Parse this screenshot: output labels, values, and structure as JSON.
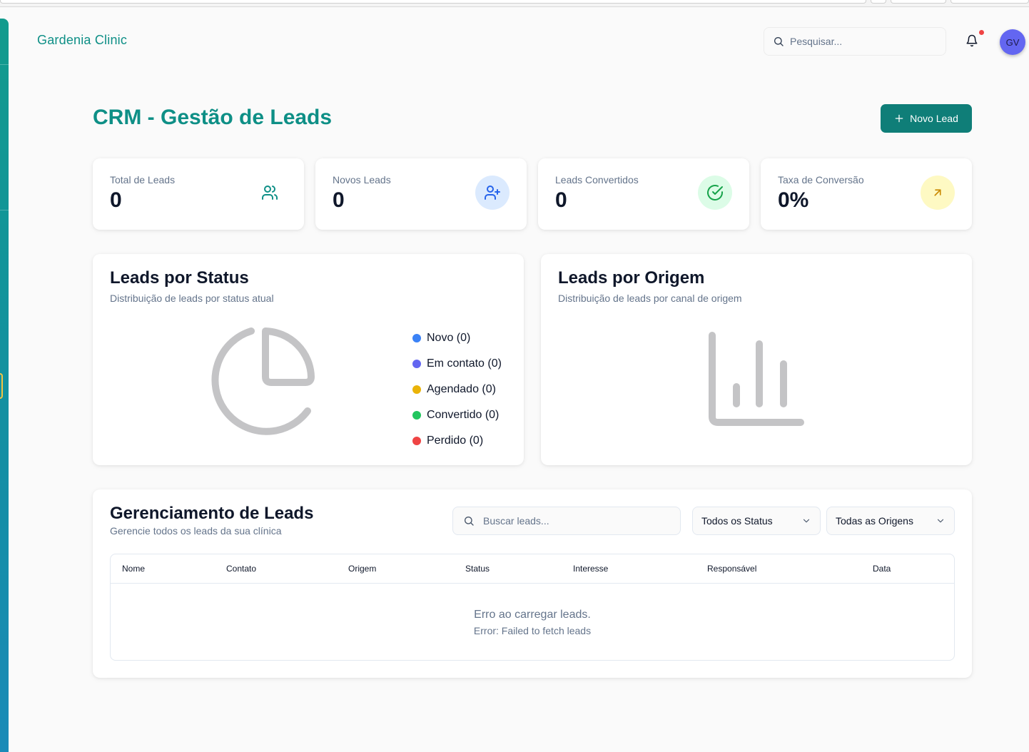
{
  "app": {
    "brand": "Gardenia Clinic"
  },
  "header": {
    "search_placeholder": "Pesquisar...",
    "avatar_initials": "GV"
  },
  "page": {
    "title": "CRM - Gestão de Leads",
    "new_lead_label": "Novo Lead"
  },
  "stats": [
    {
      "label": "Total de Leads",
      "value": "0",
      "icon": "users-icon",
      "color": "#0e8f86"
    },
    {
      "label": "Novos Leads",
      "value": "0",
      "icon": "user-plus-icon",
      "color": "#2563eb"
    },
    {
      "label": "Leads Convertidos",
      "value": "0",
      "icon": "check-circle-icon",
      "color": "#16a34a"
    },
    {
      "label": "Taxa de Conversão",
      "value": "0%",
      "icon": "arrow-up-right-icon",
      "color": "#ca8a04"
    }
  ],
  "status_panel": {
    "title": "Leads por Status",
    "subtitle": "Distribuição de leads por status atual",
    "legend": [
      {
        "label": "Novo (0)",
        "color": "#3b82f6"
      },
      {
        "label": "Em contato (0)",
        "color": "#6366f1"
      },
      {
        "label": "Agendado (0)",
        "color": "#eab308"
      },
      {
        "label": "Convertido (0)",
        "color": "#22c55e"
      },
      {
        "label": "Perdido (0)",
        "color": "#ef4444"
      }
    ]
  },
  "origin_panel": {
    "title": "Leads por Origem",
    "subtitle": "Distribuição de leads por canal de origem"
  },
  "management": {
    "title": "Gerenciamento de Leads",
    "subtitle": "Gerencie todos os leads da sua clínica",
    "search_placeholder": "Buscar leads...",
    "status_filter": "Todos os Status",
    "origin_filter": "Todas as Origens",
    "columns": [
      "Nome",
      "Contato",
      "Origem",
      "Status",
      "Interesse",
      "Responsável",
      "Data"
    ],
    "empty_message": "Erro ao carregar leads.",
    "empty_detail": "Error: Failed to fetch leads"
  },
  "colors": {
    "brand": "#0e8f86",
    "primary_button": "#0f7e78",
    "placeholder_graphic": "#c4c4c6"
  }
}
